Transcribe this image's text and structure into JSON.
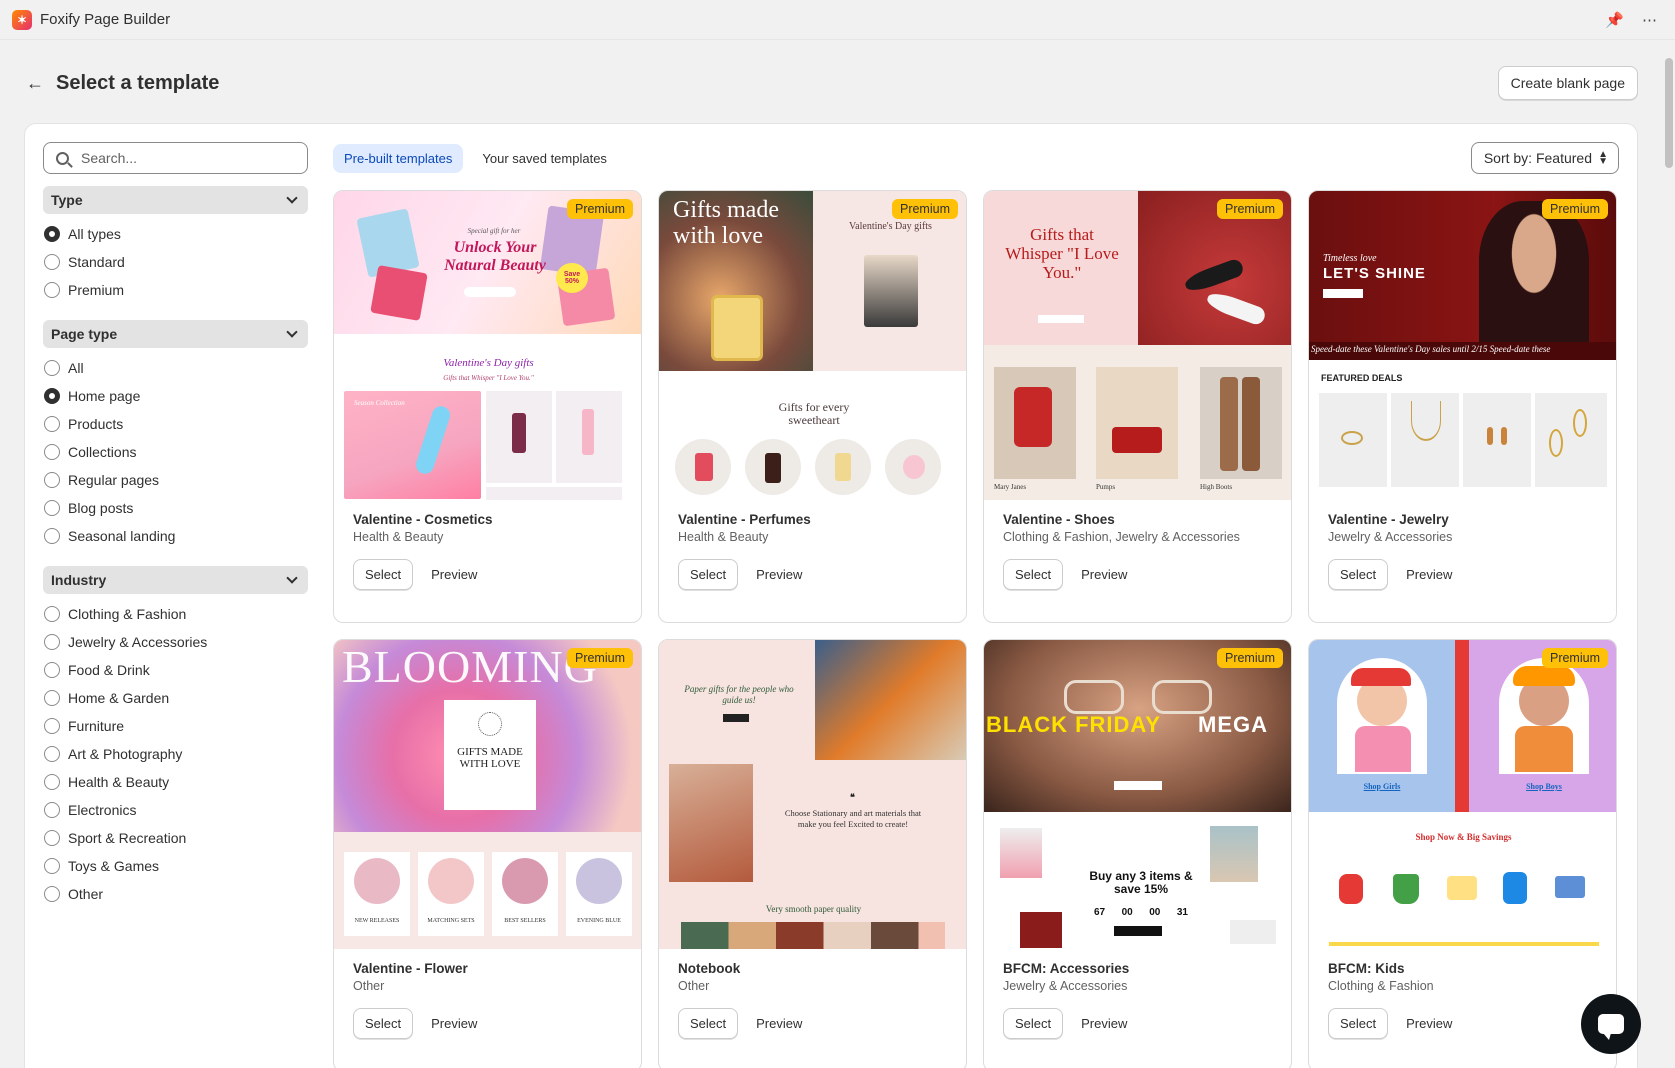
{
  "app": {
    "title": "Foxify Page Builder",
    "logo_icon": "foxify-logo-icon"
  },
  "header": {
    "title": "Select a template",
    "create_blank_label": "Create blank page"
  },
  "search": {
    "placeholder": "Search..."
  },
  "filters": {
    "type": {
      "label": "Type",
      "options": [
        "All types",
        "Standard",
        "Premium"
      ],
      "selected": "All types"
    },
    "page_type": {
      "label": "Page type",
      "options": [
        "All",
        "Home page",
        "Products",
        "Collections",
        "Regular pages",
        "Blog posts",
        "Seasonal landing"
      ],
      "selected": "Home page"
    },
    "industry": {
      "label": "Industry",
      "options": [
        "Clothing & Fashion",
        "Jewelry & Accessories",
        "Food & Drink",
        "Home & Garden",
        "Furniture",
        "Art & Photography",
        "Health & Beauty",
        "Electronics",
        "Sport & Recreation",
        "Toys & Games",
        "Other"
      ]
    }
  },
  "tabs": [
    {
      "label": "Pre-built templates",
      "active": true
    },
    {
      "label": "Your saved templates",
      "active": false
    }
  ],
  "sort": {
    "label": "Sort by: Featured"
  },
  "card_actions": {
    "select_label": "Select",
    "preview_label": "Preview"
  },
  "badge_label": "Premium",
  "templates": [
    {
      "title": "Valentine - Cosmetics",
      "category": "Health & Beauty",
      "premium": true,
      "thumb": {
        "headline": "Unlock Your Natural Beauty",
        "kicker": "Special gift for her",
        "sale": "Save 50%",
        "section": "Valentine's Day gifts",
        "sub": "Gifts that Whisper \"I Love You.\"",
        "collection": "Season Collection"
      }
    },
    {
      "title": "Valentine - Perfumes",
      "category": "Health & Beauty",
      "premium": true,
      "thumb": {
        "headline": "Gifts made with love",
        "right_title": "Valentine's Day gifts",
        "section": "Gifts for every sweetheart"
      }
    },
    {
      "title": "Valentine - Shoes",
      "category": "Clothing & Fashion, Jewelry & Accessories",
      "premium": true,
      "thumb": {
        "headline": "Gifts that Whisper \"I Love You.\"",
        "products": [
          "Mary Janes",
          "Pumps",
          "High Boots"
        ]
      }
    },
    {
      "title": "Valentine - Jewelry",
      "category": "Jewelry & Accessories",
      "premium": true,
      "thumb": {
        "kicker": "Timeless love",
        "headline": "LET'S SHINE",
        "marquee": "Speed-date   these Valentine's Day   sales until 2/15   Speed-date   these",
        "section": "FEATURED DEALS"
      }
    },
    {
      "title": "Valentine - Flower",
      "category": "Other",
      "premium": true,
      "thumb": {
        "headline": "BLOOMING",
        "card_text": "GIFTS MADE WITH LOVE",
        "products": [
          "NEW RELEASES",
          "MATCHING SETS",
          "BEST SELLERS",
          "EVENING BLUE"
        ]
      }
    },
    {
      "title": "Notebook",
      "category": "Other",
      "premium": false,
      "thumb": {
        "headline": "Paper gifts for the people who guide us!",
        "quote": "Choose Stationary and art materials that make you feel Excited to create!",
        "section": "Very smooth paper quality"
      }
    },
    {
      "title": "BFCM: Accessories",
      "category": "Jewelry & Accessories",
      "premium": true,
      "thumb": {
        "headline_a": "BLACK FRIDAY",
        "headline_b": "MEGA",
        "deal": "Buy any 3 items & save 15%",
        "countdown": [
          "67",
          "00",
          "00",
          "31"
        ]
      }
    },
    {
      "title": "BFCM: Kids",
      "category": "Clothing & Fashion",
      "premium": true,
      "thumb": {
        "link_a": "Shop Girls",
        "link_b": "Shop Boys",
        "section": "Shop Now & Big Savings"
      }
    }
  ],
  "colors": {
    "accent_tab_bg": "#e0ebff",
    "accent_tab_text": "#0b4ab8",
    "badge": "#ffc107"
  }
}
